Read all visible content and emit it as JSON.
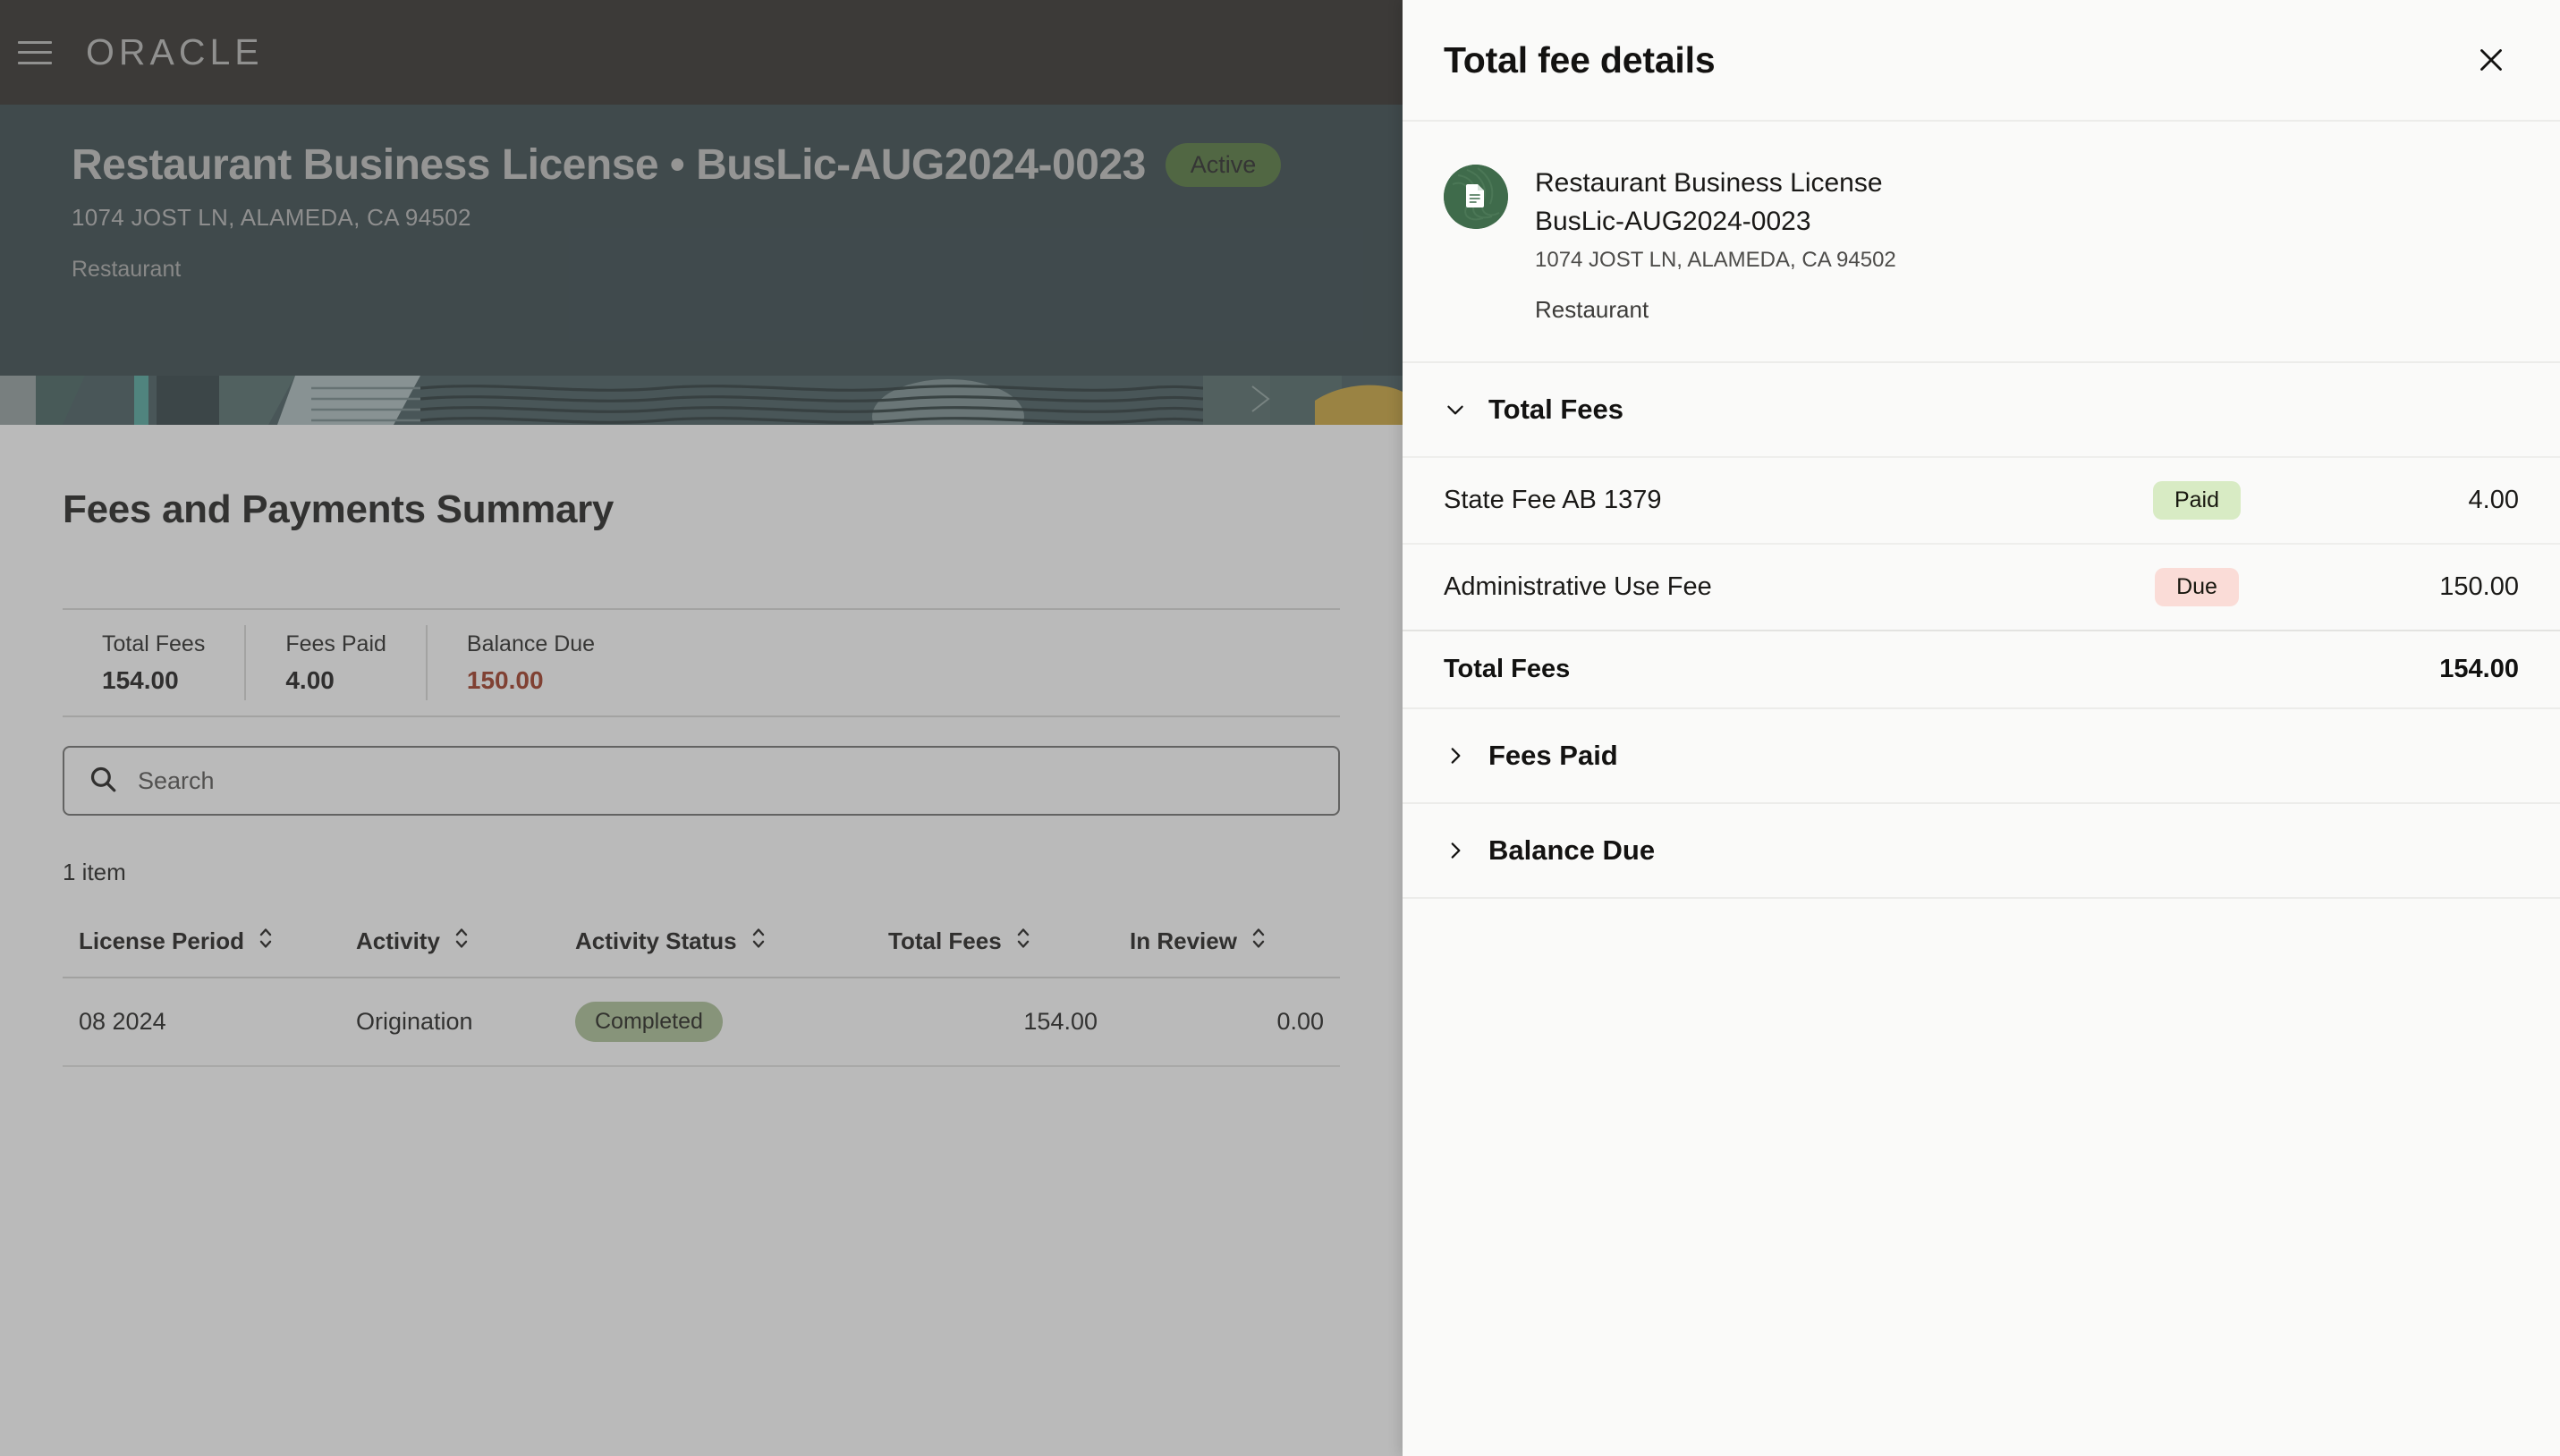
{
  "global_header": {
    "menu_icon": "hamburger-menu-icon",
    "brand": "ORACLE"
  },
  "hero": {
    "title": "Restaurant Business License • BusLic-AUG2024-0023",
    "status_badge": "Active",
    "address": "1074 JOST LN, ALAMEDA, CA 94502",
    "record_type": "Restaurant"
  },
  "page": {
    "title": "Fees and Payments Summary",
    "summary": [
      {
        "label": "Total Fees",
        "value": "154.00",
        "tone": "normal"
      },
      {
        "label": "Fees Paid",
        "value": "4.00",
        "tone": "normal"
      },
      {
        "label": "Balance Due",
        "value": "150.00",
        "tone": "danger"
      }
    ],
    "search": {
      "placeholder": "Search",
      "value": "",
      "icon": "search-icon"
    },
    "item_count": "1 item",
    "table": {
      "columns": [
        {
          "label": "License Period",
          "sortable": true
        },
        {
          "label": "Activity",
          "sortable": true
        },
        {
          "label": "Activity Status",
          "sortable": true
        },
        {
          "label": "Total Fees",
          "sortable": true
        },
        {
          "label": "In Review",
          "sortable": true
        }
      ],
      "rows": [
        {
          "license_period": "08 2024",
          "activity": "Origination",
          "activity_status": "Completed",
          "total_fees": "154.00",
          "in_review": "0.00"
        }
      ]
    }
  },
  "drawer": {
    "title": "Total fee details",
    "close_icon": "close-icon",
    "record": {
      "avatar_icon": "document-icon",
      "name_line1": "Restaurant Business License",
      "name_line2": "BusLic-AUG2024-0023",
      "address": "1074 JOST LN, ALAMEDA, CA 94502",
      "type": "Restaurant"
    },
    "sections": [
      {
        "title": "Total Fees",
        "expanded": true,
        "chevron": "chevron-down-icon",
        "rows": [
          {
            "name": "State Fee AB 1379",
            "badge": "Paid",
            "badge_tone": "paid",
            "amount": "4.00"
          },
          {
            "name": "Administrative Use Fee",
            "badge": "Due",
            "badge_tone": "due",
            "amount": "150.00"
          }
        ],
        "total": {
          "name": "Total Fees",
          "amount": "154.00"
        }
      },
      {
        "title": "Fees Paid",
        "expanded": false,
        "chevron": "chevron-right-icon"
      },
      {
        "title": "Balance Due",
        "expanded": false,
        "chevron": "chevron-right-icon"
      }
    ]
  },
  "colors": {
    "header_bg": "#26231f",
    "hero_bg": "#2d3e43",
    "status_active": "#4b7032",
    "badge_completed": "#a7bd92",
    "badge_paid": "#d8ebc4",
    "badge_due": "#fadcd7",
    "danger_text": "#9b2f18",
    "link": "#1b5b7d",
    "avatar_green": "#3f6b4b",
    "drawer_bg": "#fafaf9"
  }
}
